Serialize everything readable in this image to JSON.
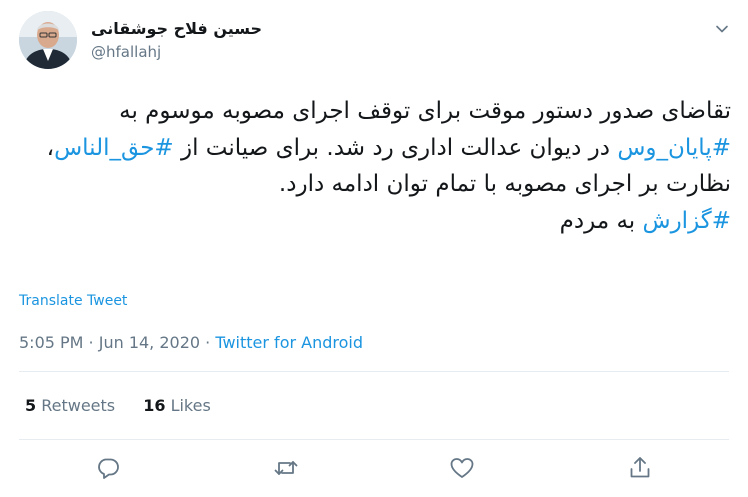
{
  "tweet": {
    "author": {
      "display_name": "حسین فلاح جوشقانی",
      "handle": "@hfallahj"
    },
    "text": {
      "part1": "تقاضای صدور دستور موقت برای توقف اجرای مصوبه موسوم به ",
      "hashtag1": "#پایان_وس",
      "part2": " در دیوان عدالت اداری رد شد. برای صیانت از ",
      "hashtag2": "#حق_الناس",
      "part3": "، نظارت بر اجرای مصوبه با تمام توان ادامه دارد.\n",
      "hashtag3": "#گزارش",
      "part4": " به مردم"
    },
    "translate_label": "Translate Tweet",
    "time": "5:05 PM",
    "separator": " · ",
    "date": "Jun 14, 2020",
    "separator2": " · ",
    "source": "Twitter for Android",
    "stats": {
      "retweets_count": "5",
      "retweets_label": " Retweets",
      "likes_count": "16",
      "likes_label": " Likes"
    }
  },
  "icons": {
    "caret": "chevron-down-icon",
    "reply": "reply-icon",
    "retweet": "retweet-icon",
    "like": "heart-icon",
    "share": "share-icon"
  },
  "colors": {
    "accent": "#1b95e0",
    "secondary_text": "#657786",
    "primary_text": "#14171a",
    "divider": "#e6ecf0"
  }
}
